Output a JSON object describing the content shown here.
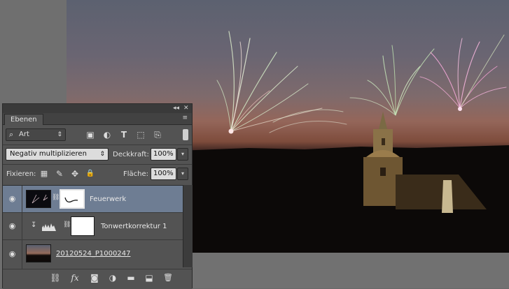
{
  "panel": {
    "collapse_label": "◂◂",
    "close_label": "✕",
    "tab_title": "Ebenen",
    "menu_icon_label": "≡",
    "filter": {
      "label": "Art",
      "search_icon": "⌕",
      "arrows": "⇕"
    },
    "filter_icons": {
      "image": "▣",
      "adjustment": "◐",
      "type": "T",
      "shape": "⬚",
      "smart": "⎘"
    },
    "blend_mode": {
      "value": "Negativ multiplizieren",
      "arrows": "⇕"
    },
    "opacity": {
      "label": "Deckkraft:",
      "value": "100%",
      "arrow": "▾"
    },
    "lock": {
      "label": "Fixieren:",
      "icons": {
        "transparent": "▦",
        "brush": "✎",
        "move": "✥",
        "lock": "🔒"
      }
    },
    "fill": {
      "label": "Fläche:",
      "value": "100%",
      "arrow": "▾"
    },
    "layers": [
      {
        "name": "Feuerwerk",
        "selected": true,
        "visible_icon": "◉",
        "link_icon": "⛓"
      },
      {
        "name": "Tonwertkorrektur 1",
        "selected": false,
        "visible_icon": "◉",
        "link_icon": "⛓",
        "clip_icon": "↧"
      },
      {
        "name": "20120524_P1000247",
        "selected": false,
        "visible_icon": "◉"
      }
    ],
    "bottom_icons": {
      "link": "⛓",
      "fx": "fx",
      "mask": "◙",
      "adjustment": "◑",
      "group": "▬",
      "new_layer": "⬓",
      "delete": "🗑"
    }
  },
  "colors": {
    "panel_bg": "#535353",
    "selected_layer": "#6e7d93",
    "sky_top": "#5c6170",
    "sky_glow": "#94665a"
  }
}
